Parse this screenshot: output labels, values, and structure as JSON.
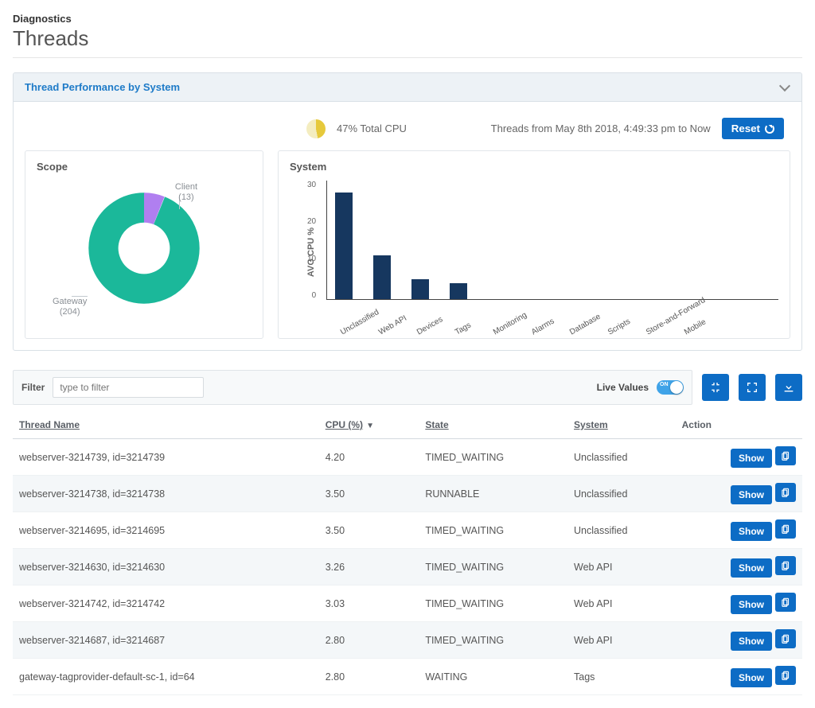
{
  "header": {
    "breadcrumb": "Diagnostics",
    "title": "Threads"
  },
  "panel": {
    "title": "Thread Performance by System",
    "cpu_summary": "47% Total CPU",
    "time_range": "Threads from May 8th 2018, 4:49:33 pm to Now",
    "reset_label": "Reset"
  },
  "scope_chart": {
    "title": "Scope",
    "client_label": "Client",
    "client_count": "(13)",
    "gateway_label": "Gateway",
    "gateway_count": "(204)"
  },
  "system_chart": {
    "title": "System",
    "ylabel": "AVG CPU %"
  },
  "chart_data": [
    {
      "type": "pie",
      "title": "Scope",
      "series": [
        {
          "name": "Gateway",
          "value": 204,
          "color": "#1bb89a"
        },
        {
          "name": "Client",
          "value": 13,
          "color": "#b07ff0"
        }
      ]
    },
    {
      "type": "bar",
      "title": "System",
      "ylabel": "AVG CPU %",
      "ylim": [
        0,
        30
      ],
      "yticks": [
        0,
        10,
        20,
        30
      ],
      "categories": [
        "Unclassified",
        "Web API",
        "Devices",
        "Tags",
        "Monitoring",
        "Alarms",
        "Database",
        "Scripts",
        "Store-and-Forward",
        "Mobile"
      ],
      "values": [
        27,
        11,
        5,
        4,
        0,
        0,
        0,
        0,
        0,
        0
      ]
    }
  ],
  "filter": {
    "label": "Filter",
    "placeholder": "type to filter",
    "live_values_label": "Live Values"
  },
  "table": {
    "headers": {
      "name": "Thread Name",
      "cpu": "CPU (%)",
      "state": "State",
      "system": "System",
      "action": "Action"
    },
    "show_label": "Show",
    "rows": [
      {
        "name": "webserver-3214739, id=3214739",
        "cpu": "4.20",
        "state": "TIMED_WAITING",
        "system": "Unclassified"
      },
      {
        "name": "webserver-3214738, id=3214738",
        "cpu": "3.50",
        "state": "RUNNABLE",
        "system": "Unclassified"
      },
      {
        "name": "webserver-3214695, id=3214695",
        "cpu": "3.50",
        "state": "TIMED_WAITING",
        "system": "Unclassified"
      },
      {
        "name": "webserver-3214630, id=3214630",
        "cpu": "3.26",
        "state": "TIMED_WAITING",
        "system": "Web API"
      },
      {
        "name": "webserver-3214742, id=3214742",
        "cpu": "3.03",
        "state": "TIMED_WAITING",
        "system": "Web API"
      },
      {
        "name": "webserver-3214687, id=3214687",
        "cpu": "2.80",
        "state": "TIMED_WAITING",
        "system": "Web API"
      },
      {
        "name": "gateway-tagprovider-default-sc-1, id=64",
        "cpu": "2.80",
        "state": "WAITING",
        "system": "Tags"
      }
    ]
  }
}
